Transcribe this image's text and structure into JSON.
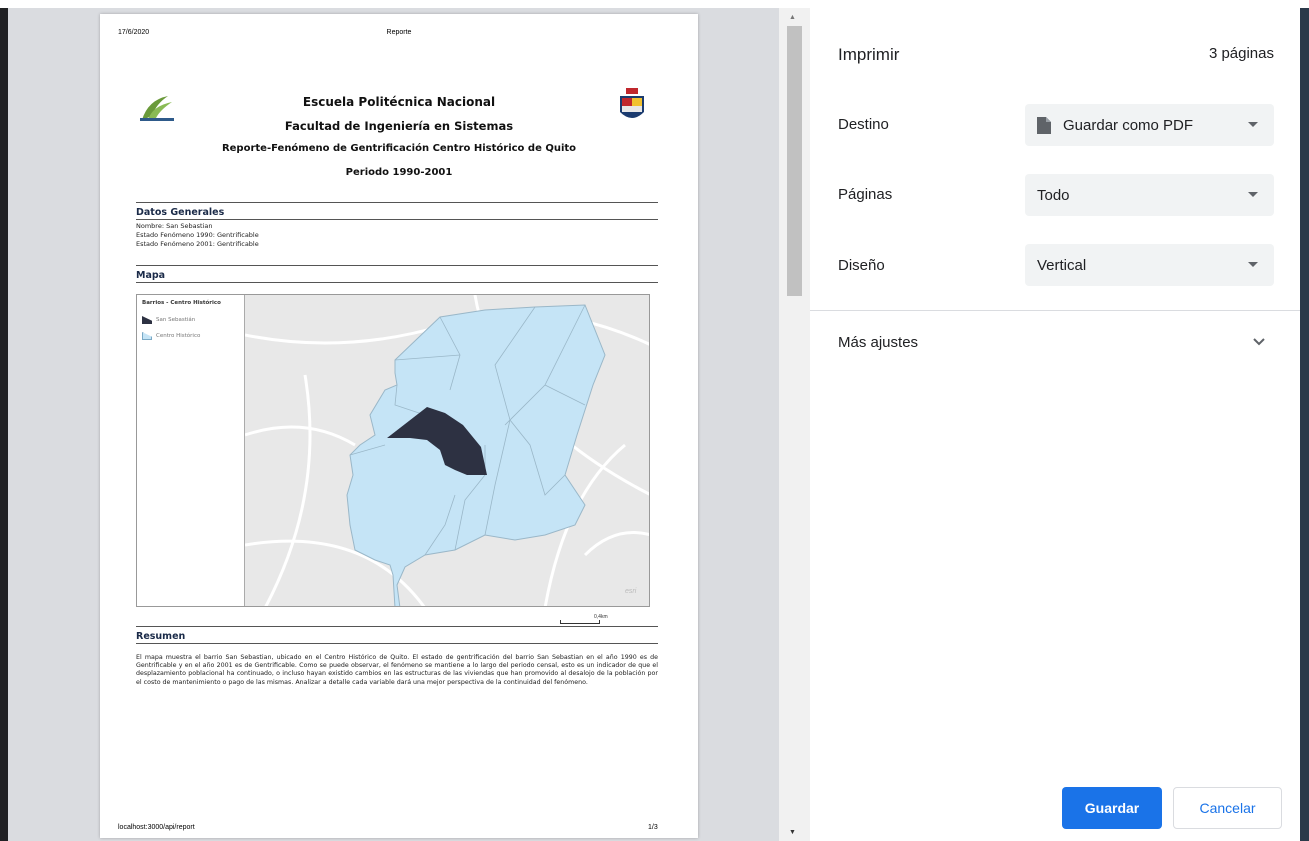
{
  "preview": {
    "header_date": "17/6/2020",
    "header_title": "Reporte",
    "footer_url": "localhost:3000/api/report",
    "footer_page": "1/3",
    "title_1": "Escuela Politécnica Nacional",
    "title_2": "Facultad de Ingeniería en Sistemas",
    "title_3": "Reporte-Fenómeno de Gentrificación Centro Histórico de Quito",
    "title_4": "Periodo 1990-2001",
    "datos_generales": {
      "heading": "Datos Generales",
      "nombre": "Nombre: San Sebastian",
      "estado_1990": "Estado Fenómeno 1990: Gentrificable",
      "estado_2001": "Estado Fenómeno 2001: Gentrificable"
    },
    "mapa": {
      "heading": "Mapa",
      "legend_title": "Barrios - Centro Histórico",
      "legend_items": [
        "San Sebastián",
        "Centro Histórico"
      ],
      "legend_colors": [
        "#2d3142",
        "#c5e4f6"
      ],
      "attribution": "esri",
      "scale_label": "0,4km"
    },
    "resumen": {
      "heading": "Resumen",
      "text": "El mapa muestra el barrio San Sebastian, ubicado en el Centro Histórico de Quito. El estado de gentrificación del barrio San Sebastian en el año 1990 es de Gentrificable y en el año 2001 es de Gentrificable. Como se puede observar, el fenómeno se mantiene a lo largo del periodo censal, esto es un indicador de que el desplazamiento poblacional ha continuado, o incluso hayan existido cambios en las estructuras de las viviendas que han promovido al desalojo de la población por el costo de mantenimiento o pago de las mismas. Analizar a detalle cada variable dará una mejor perspectiva de la continuidad del fenómeno."
    }
  },
  "print_panel": {
    "title": "Imprimir",
    "page_count": "3 páginas",
    "destino_label": "Destino",
    "destino_value": "Guardar como PDF",
    "paginas_label": "Páginas",
    "paginas_value": "Todo",
    "diseno_label": "Diseño",
    "diseno_value": "Vertical",
    "mas_ajustes": "Más ajustes",
    "save_label": "Guardar",
    "cancel_label": "Cancelar",
    "accent_color": "#1a73e8"
  }
}
